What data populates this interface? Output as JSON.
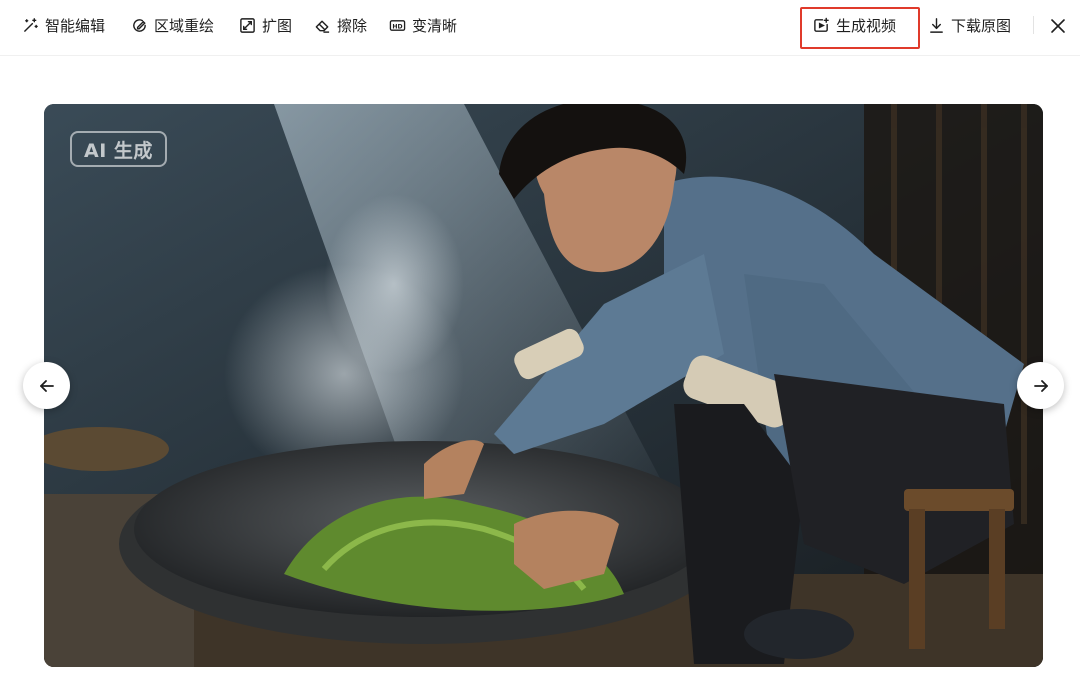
{
  "toolbar": {
    "tools": [
      {
        "label": "智能编辑",
        "icon": "magic-wand-icon"
      },
      {
        "label": "区域重绘",
        "icon": "brush-circle-icon"
      },
      {
        "label": "扩图",
        "icon": "expand-icon"
      },
      {
        "label": "擦除",
        "icon": "eraser-icon"
      },
      {
        "label": "变清晰",
        "icon": "hd-icon"
      }
    ],
    "generate_video": {
      "label": "生成视频",
      "icon": "video-plus-icon",
      "highlighted": true,
      "highlight_color": "#e03a2b"
    },
    "download": {
      "label": "下载原图",
      "icon": "download-icon"
    },
    "close": {
      "icon": "close-icon"
    }
  },
  "image": {
    "badge": "AI 生成",
    "description_icon": "generated-image"
  },
  "navigation": {
    "prev_icon": "arrow-left-icon",
    "next_icon": "arrow-right-icon"
  }
}
